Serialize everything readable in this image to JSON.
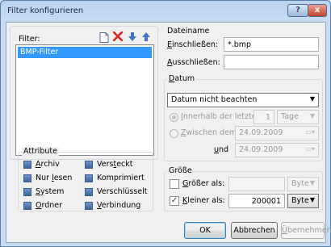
{
  "window": {
    "title": "Filter konfigurieren",
    "help_glyph": "?",
    "close_glyph": "x"
  },
  "filter": {
    "label": "Filter:",
    "items": [
      "BMP-Filter"
    ],
    "icons": {
      "new": "new-document-icon",
      "delete": "red-x-delete-icon",
      "down": "arrow-down-icon",
      "up": "arrow-up-icon"
    }
  },
  "attribute": {
    "label": "Attribute",
    "left": [
      "Archiv",
      "Nur lesen",
      "System",
      "Ordner"
    ],
    "right": [
      "Versteckt",
      "Komprimiert",
      "Verschlüsselt",
      "Verbindung"
    ]
  },
  "dateiname": {
    "label": "Dateiname",
    "einschliessen_label": "Einschließen:",
    "einschliessen_value": "*.bmp",
    "ausschliessen_label": "Ausschließen:",
    "ausschliessen_value": ""
  },
  "datum": {
    "label": "Datum",
    "mode_selected": "Datum nicht beachten",
    "innerhalb_label": "Innerhalb der letzten",
    "innerhalb_value": "1",
    "innerhalb_unit": "Tage",
    "zwischen_label": "Zwischen dem",
    "zwischen_value": "24.09.2009",
    "und_label": "und",
    "und_value": "24.09.2009"
  },
  "groesse": {
    "label": "Größe",
    "groesser_label": "Größer als:",
    "groesser_value": "",
    "groesser_unit": "Byte",
    "kleiner_label": "Kleiner als:",
    "kleiner_value": "200001",
    "kleiner_unit": "Byte",
    "kleiner_checked": true,
    "groesser_checked": false
  },
  "buttons": {
    "ok": "OK",
    "cancel": "Abbrechen",
    "apply": "Übernehmen"
  }
}
